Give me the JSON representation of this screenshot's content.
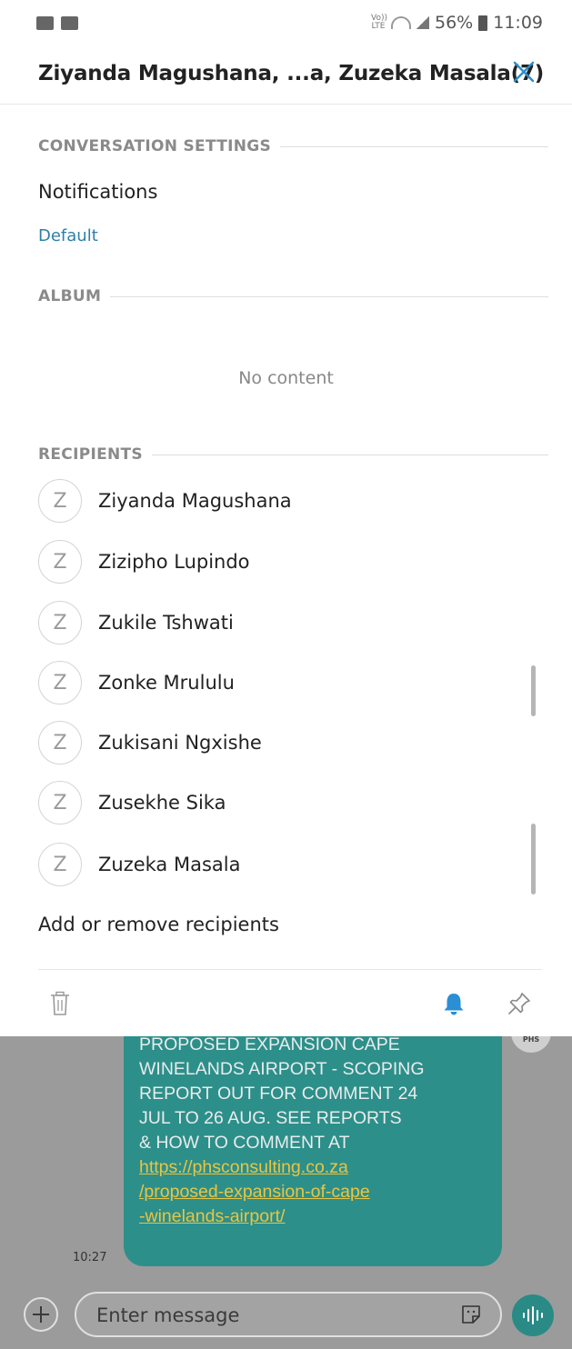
{
  "status_bar": {
    "volte_label": "Vo)) LTE",
    "battery": "56%",
    "time": "11:09"
  },
  "header": {
    "title": "Ziyanda Magushana, ...a, Zuzeka Masala(7)"
  },
  "settings": {
    "section_title": "CONVERSATION SETTINGS",
    "notifications_label": "Notifications",
    "notifications_value": "Default"
  },
  "album": {
    "section_title": "ALBUM",
    "empty_text": "No content"
  },
  "recipients": {
    "section_title": "RECIPIENTS",
    "items": [
      {
        "initial": "Z",
        "name": "Ziyanda Magushana"
      },
      {
        "initial": "Z",
        "name": "Zizipho Lupindo"
      },
      {
        "initial": "Z",
        "name": "Zukile Tshwati"
      },
      {
        "initial": "Z",
        "name": "Zonke Mrululu"
      },
      {
        "initial": "Z",
        "name": "Zukisani Ngxishe"
      },
      {
        "initial": "Z",
        "name": "Zusekhe Sika"
      },
      {
        "initial": "Z",
        "name": "Zuzeka Masala"
      }
    ],
    "add_remove_label": "Add or remove recipients"
  },
  "toolbar": {
    "icons": [
      "trash-icon",
      "bell-icon",
      "pin-icon"
    ],
    "accent": "#2a8fd4"
  },
  "message": {
    "lines": [
      "PROPOSED EXPANSION CAPE",
      "WINELANDS AIRPORT - SCOPING",
      "REPORT OUT FOR COMMENT 24",
      "JUL TO 26 AUG. SEE REPORTS",
      "& HOW TO COMMENT AT"
    ],
    "link_lines": [
      "https://phsconsulting.co.za",
      "/proposed-expansion-of-cape",
      "-winelands-airport/"
    ],
    "time": "10:27",
    "sender_avatar": "PHS",
    "bubble_color": "#2d8f8a",
    "link_color": "#e9c542"
  },
  "input": {
    "placeholder": "Enter message"
  }
}
